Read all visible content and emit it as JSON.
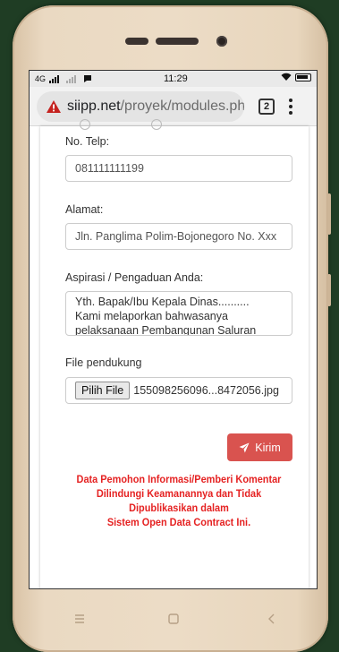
{
  "status_bar": {
    "network": "4G",
    "time": "11:29"
  },
  "browser": {
    "url_host": "siipp.net",
    "url_path": "/proyek/modules.php",
    "tab_count": "2"
  },
  "form": {
    "phone_label": "No. Telp:",
    "phone_value": "081111111199",
    "address_label": "Alamat:",
    "address_value": "Jln. Panglima Polim-Bojonegoro No. Xxx",
    "complaint_label": "Aspirasi / Pengaduan Anda:",
    "complaint_lines": [
      "Yth. Bapak/Ibu Kepala Dinas..........",
      "Kami melaporkan bahwasanya",
      "pelaksanaan Pembangunan Saluran"
    ],
    "file_label": "File pendukung",
    "file_button": "Pilih File",
    "file_name": "155098256096...8472056.jpg",
    "submit_label": "Kirim",
    "notice_lines": [
      "Data Pemohon Informasi/Pemberi Komentar",
      "Dilindungi Keamanannya dan Tidak",
      "Dipublikasikan dalam",
      "Sistem Open Data Contract Ini."
    ]
  },
  "colors": {
    "submit": "#d9534f",
    "notice": "#e52222",
    "phone_frame": "#ecdcc6",
    "background": "#1f3d24"
  }
}
